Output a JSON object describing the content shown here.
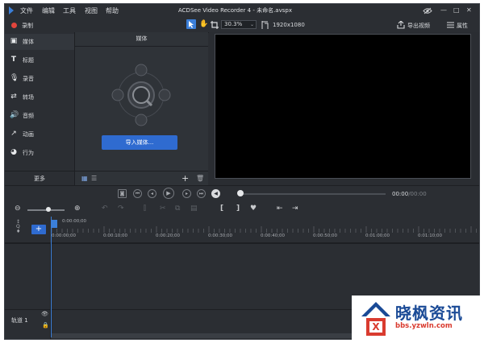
{
  "menu": [
    "文件",
    "编辑",
    "工具",
    "视图",
    "帮助"
  ],
  "window_title": "ACDSee Video Recorder 4 - 未命名.avspx",
  "toolbar": {
    "record_label": "录制",
    "zoom_value": "30.3%",
    "resolution": "1920x1080",
    "export_label": "导出视频",
    "properties_label": "属性"
  },
  "sidebar": {
    "items": [
      {
        "label": "媒体",
        "icon": "media-icon"
      },
      {
        "label": "标题",
        "icon": "title-icon"
      },
      {
        "label": "录音",
        "icon": "microphone-icon"
      },
      {
        "label": "转场",
        "icon": "transition-icon"
      },
      {
        "label": "音频",
        "icon": "audio-icon"
      },
      {
        "label": "动画",
        "icon": "animation-icon"
      },
      {
        "label": "行为",
        "icon": "behavior-icon"
      }
    ],
    "more_label": "更多"
  },
  "media_panel": {
    "header": "媒体",
    "import_button": "导入媒体..."
  },
  "playback": {
    "time_current": "00:00",
    "time_total": "/00:00"
  },
  "timeline": {
    "playhead_time": "0:00:00;00",
    "ruler_labels": [
      "0:00:00;00",
      "0:00:10;00",
      "0:00:20;00",
      "0:00:30;00",
      "0:00:40;00",
      "0:00:50;00",
      "0:01:00;00",
      "0:01:10;00",
      "0:01:20;00"
    ],
    "track_label": "轨道 1"
  },
  "watermark": {
    "title": "晓枫资讯",
    "url": "bbs.yzwln.com"
  },
  "colors": {
    "accent": "#2f6bd0",
    "record": "#e2453c",
    "panel": "#2b2e33"
  }
}
